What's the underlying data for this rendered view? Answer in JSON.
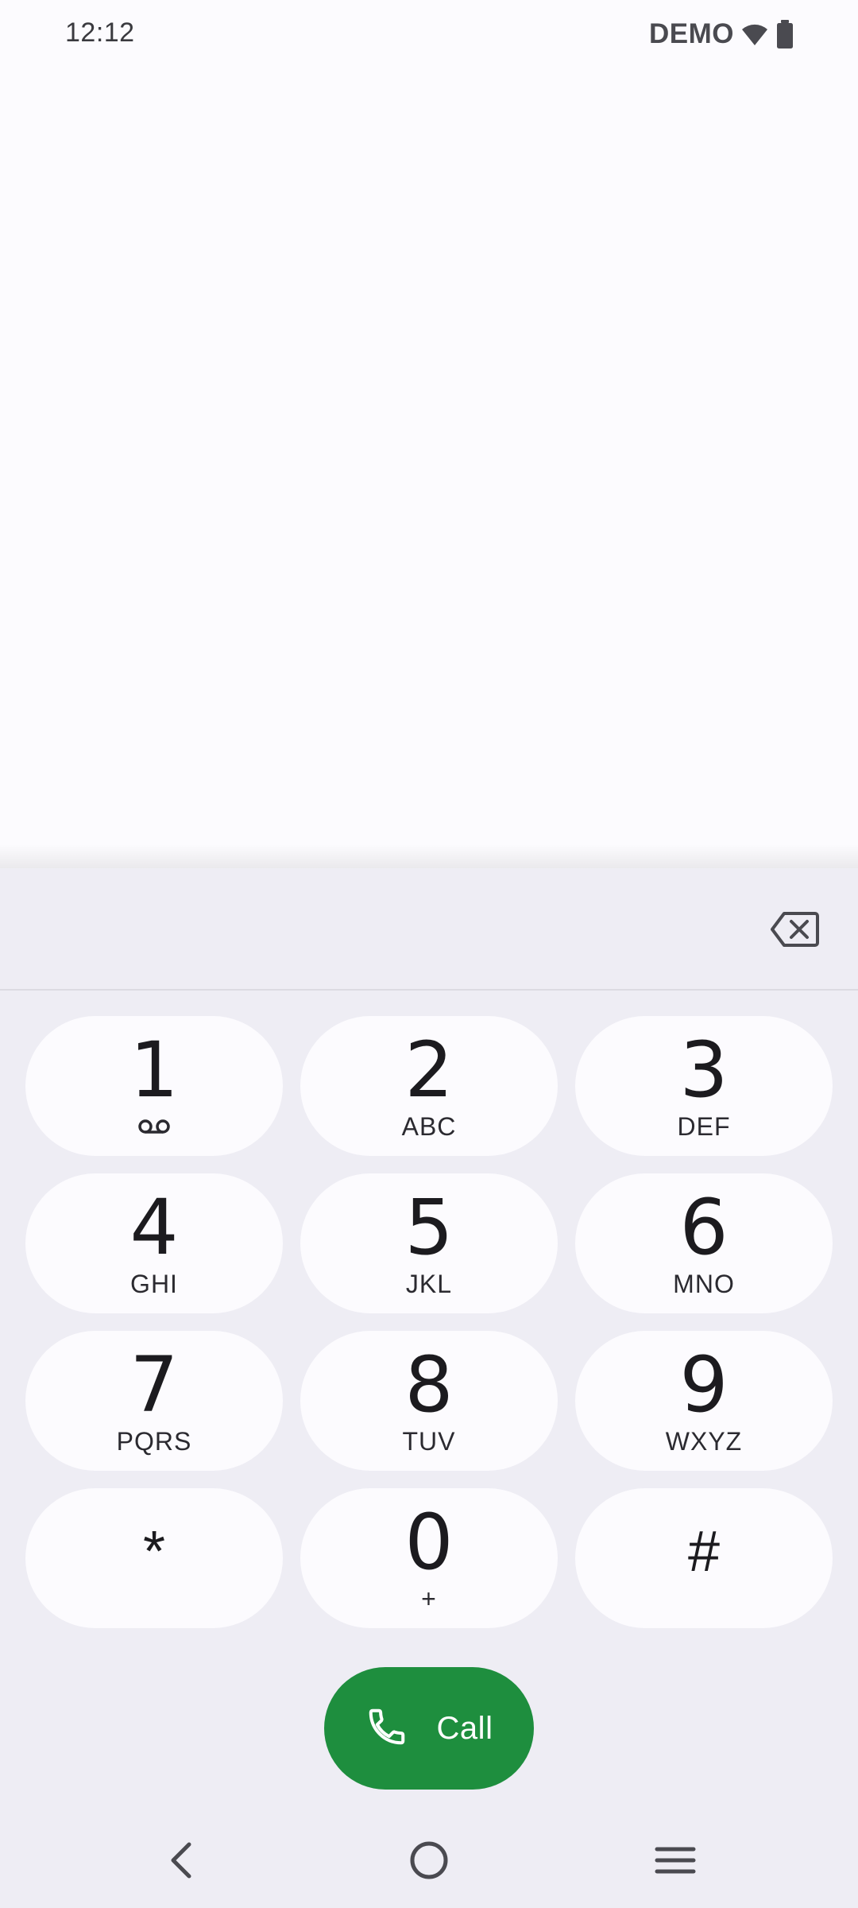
{
  "status_bar": {
    "time": "12:12",
    "carrier": "DEMO",
    "icons": [
      "wifi-icon",
      "battery-icon"
    ]
  },
  "dialpad": {
    "digits_value": "",
    "keys": [
      {
        "digit": "1",
        "letters": "",
        "icon": "voicemail-icon"
      },
      {
        "digit": "2",
        "letters": "ABC"
      },
      {
        "digit": "3",
        "letters": "DEF"
      },
      {
        "digit": "4",
        "letters": "GHI"
      },
      {
        "digit": "5",
        "letters": "JKL"
      },
      {
        "digit": "6",
        "letters": "MNO"
      },
      {
        "digit": "7",
        "letters": "PQRS"
      },
      {
        "digit": "8",
        "letters": "TUV"
      },
      {
        "digit": "9",
        "letters": "WXYZ"
      },
      {
        "digit": "*",
        "letters": ""
      },
      {
        "digit": "0",
        "letters": "+"
      },
      {
        "digit": "#",
        "letters": ""
      }
    ],
    "call_label": "Call",
    "call_color": "#1e8e3e"
  },
  "nav_bar": {
    "icons": [
      "back-icon",
      "home-icon",
      "recents-icon"
    ]
  }
}
